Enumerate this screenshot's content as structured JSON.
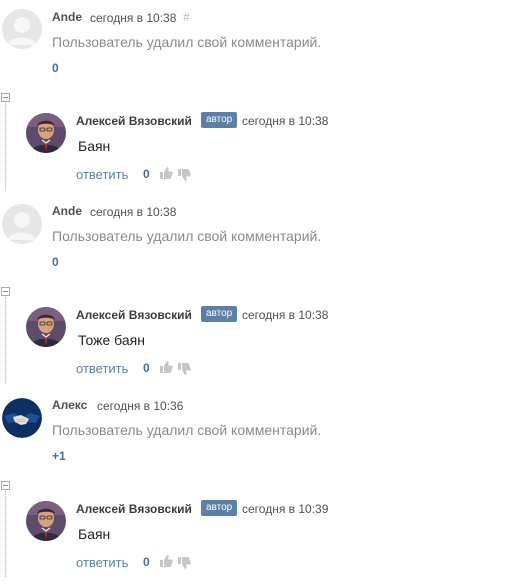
{
  "comments": [
    {
      "author": "Ande",
      "time": "сегодня в 10:38",
      "hash": "#",
      "text": "Пользователь удалил свой комментарий.",
      "score": "0"
    },
    {
      "author": "Алексей Вязовский",
      "badge": "автор",
      "time": "сегодня в 10:38",
      "text": "Баян",
      "reply": "ответить",
      "score": "0"
    },
    {
      "author": "Ande",
      "time": "сегодня в 10:38",
      "text": "Пользователь удалил свой комментарий.",
      "score": "0"
    },
    {
      "author": "Алексей Вязовский",
      "badge": "автор",
      "time": "сегодня в 10:38",
      "text": "Тоже баян",
      "reply": "ответить",
      "score": "0"
    },
    {
      "author": "Алекс",
      "time": "сегодня в 10:36",
      "text": "Пользователь удалил свой комментарий.",
      "score": "+1"
    },
    {
      "author": "Алексей Вязовский",
      "badge": "автор",
      "time": "сегодня в 10:39",
      "text": "Баян",
      "reply": "ответить",
      "score": "0"
    }
  ],
  "icons": {
    "default_avatar": "user-silhouette-icon",
    "photo_avatar": "author-photo",
    "handshake_avatar": "handshake-icon",
    "like": "thumbs-up-icon",
    "dislike": "thumbs-down-icon",
    "collapse": "collapse-icon"
  },
  "colors": {
    "badge": "#5b7fa6",
    "link": "#5a80a8",
    "deleted_text": "#8a8a8a",
    "score": "#4a6c8f"
  }
}
